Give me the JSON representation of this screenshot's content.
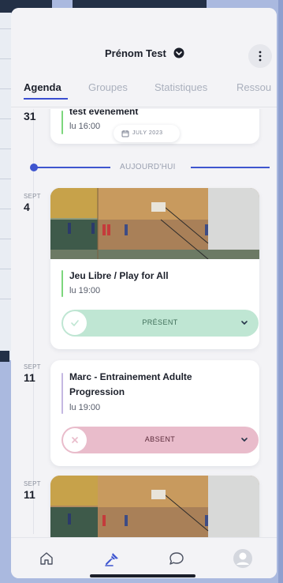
{
  "header": {
    "user_name": "Prénom Test"
  },
  "tabs": [
    {
      "label": "Agenda",
      "active": true
    },
    {
      "label": "Groupes",
      "active": false
    },
    {
      "label": "Statistiques",
      "active": false
    },
    {
      "label": "Ressou",
      "active": false
    }
  ],
  "month_chip": {
    "label": "JULY 2023"
  },
  "today_label": "AUJOURD'HUI",
  "events": [
    {
      "date_month": "",
      "date_day": "31",
      "title": "test événement",
      "time": "lu 16:00",
      "accent": "#7cd67c"
    },
    {
      "date_month": "SEPT",
      "date_day": "4",
      "title": "Jeu Libre / Play for All",
      "time": "lu 19:00",
      "accent": "#7cd67c",
      "status": "PRÉSENT",
      "status_color": "#bfe6d3"
    },
    {
      "date_month": "SEPT",
      "date_day": "11",
      "title_line1": "Marc - Entrainement Adulte",
      "title_line2": "Progression",
      "time": "lu 19:00",
      "accent": "#c4b8e2",
      "status": "ABSENT",
      "status_color": "#e9bccb"
    },
    {
      "date_month": "SEPT",
      "date_day": "11"
    }
  ],
  "nav": [
    {
      "icon": "home-icon"
    },
    {
      "icon": "badminton-shuttlecock-icon",
      "active": true
    },
    {
      "icon": "chat-bubble-icon"
    },
    {
      "icon": "profile-avatar-icon"
    }
  ],
  "colors": {
    "accent_blue": "#3e55cf",
    "present_green": "#bfe6d3",
    "absent_pink": "#e9bccb"
  }
}
